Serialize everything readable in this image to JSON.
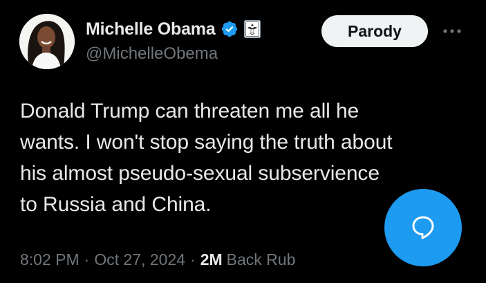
{
  "author": {
    "display_name": "Michelle Obama",
    "handle": "@MichelleObema",
    "verified_icon": "verified-badge-icon",
    "affiliation_icon": "government-seal-icon"
  },
  "actions": {
    "parody_label": "Parody",
    "more_icon": "more-horizontal-icon",
    "reply_icon": "reply-bubble-icon"
  },
  "tweet": {
    "text": "Donald Trump can threaten me all he\nwants. I won't stop saying the truth about\nhis almost pseudo-sexual subservience\nto Russia and China.",
    "time": "8:02 PM",
    "date": "Oct 27, 2024",
    "separator": "·",
    "views_count": "2M",
    "views_label": "Back Rub"
  },
  "colors": {
    "background": "#000000",
    "primary_text": "#e7e9ea",
    "secondary_text": "#71767b",
    "accent_blue": "#1d9bf0",
    "parody_button_bg": "#eff3f4"
  }
}
